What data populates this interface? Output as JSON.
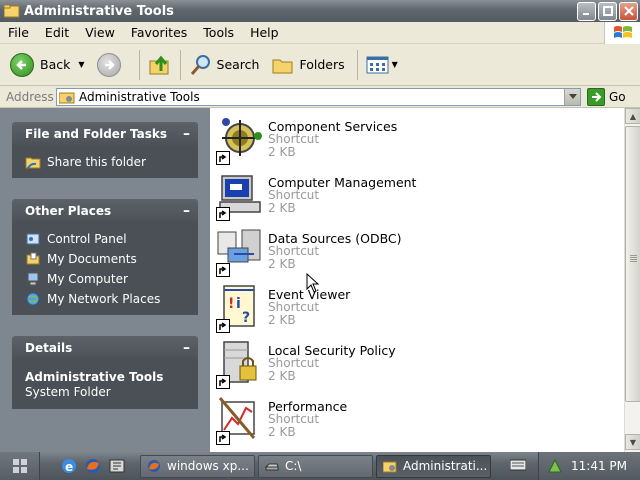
{
  "window": {
    "title": "Administrative Tools"
  },
  "menu": [
    "File",
    "Edit",
    "View",
    "Favorites",
    "Tools",
    "Help"
  ],
  "toolbar": {
    "back": "Back",
    "search": "Search",
    "folders": "Folders"
  },
  "address": {
    "label": "Address",
    "value": "Administrative Tools",
    "go": "Go"
  },
  "tasks_panel": {
    "title": "File and Folder Tasks",
    "items": [
      "Share this folder"
    ]
  },
  "places_panel": {
    "title": "Other Places",
    "items": [
      "Control Panel",
      "My Documents",
      "My Computer",
      "My Network Places"
    ]
  },
  "details_panel": {
    "title": "Details",
    "name": "Administrative Tools",
    "type": "System Folder"
  },
  "items": [
    {
      "name": "Component Services",
      "type": "Shortcut",
      "size": "2 KB"
    },
    {
      "name": "Computer Management",
      "type": "Shortcut",
      "size": "2 KB"
    },
    {
      "name": "Data Sources (ODBC)",
      "type": "Shortcut",
      "size": "2 KB"
    },
    {
      "name": "Event Viewer",
      "type": "Shortcut",
      "size": "2 KB"
    },
    {
      "name": "Local Security Policy",
      "type": "Shortcut",
      "size": "2 KB"
    },
    {
      "name": "Performance",
      "type": "Shortcut",
      "size": "2 KB"
    }
  ],
  "taskbar": {
    "tasks": [
      "windows xp...",
      "C:\\",
      "Administrati..."
    ],
    "clock": "11:41 PM"
  },
  "colors": {
    "panel_body": "#4a5056",
    "panel_header": "#5c6268",
    "left_bg": "#7e8790",
    "title_bar": "#5f666d"
  }
}
